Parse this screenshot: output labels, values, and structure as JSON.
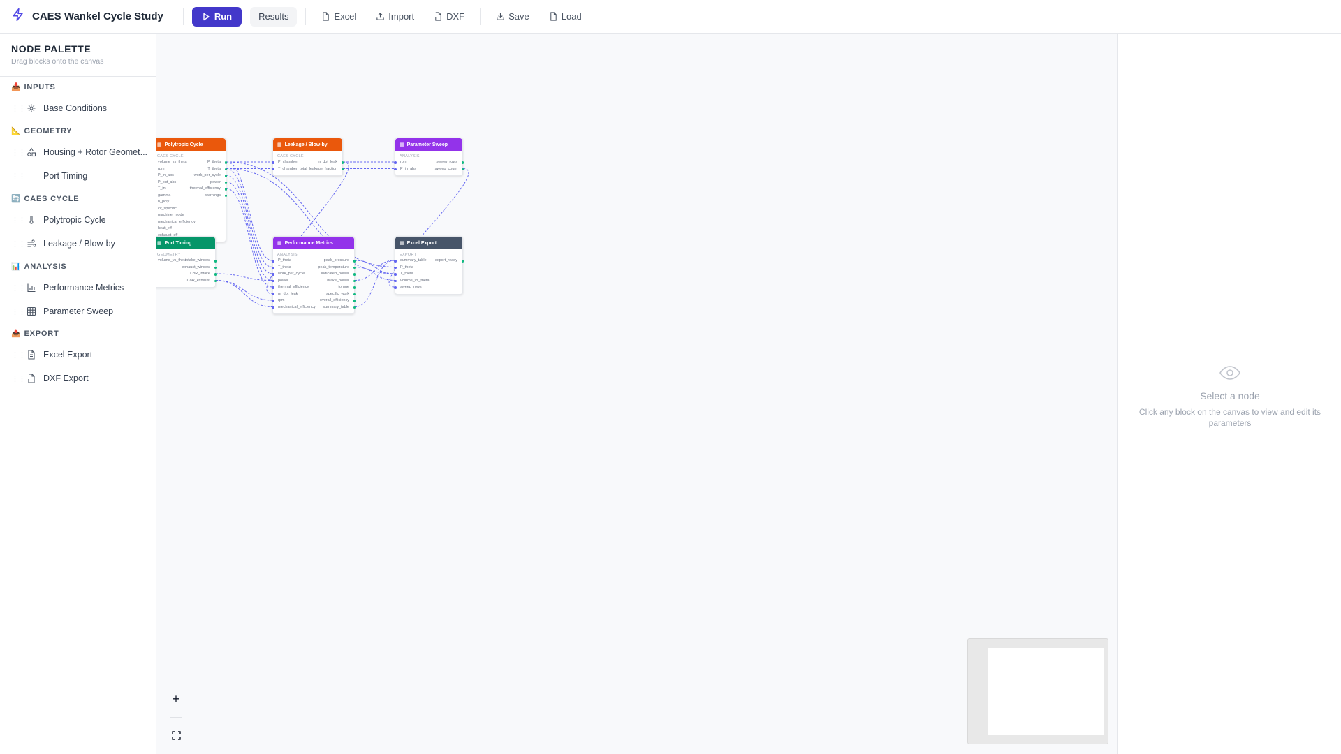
{
  "app": {
    "title": "CAES Wankel Cycle Study"
  },
  "toolbar": {
    "run_label": "Run",
    "results_label": "Results",
    "excel_label": "Excel",
    "import_label": "Import",
    "dxf_label": "DXF",
    "save_label": "Save",
    "load_label": "Load",
    "accent": "#4338ca"
  },
  "sidebar": {
    "title": "NODE PALETTE",
    "subtitle": "Drag blocks onto the canvas",
    "categories": [
      {
        "label": "INPUTS",
        "emoji": "📥"
      },
      {
        "label": "GEOMETRY",
        "emoji": "📐"
      },
      {
        "label": "CAES CYCLE",
        "emoji": "🔄"
      },
      {
        "label": "ANALYSIS",
        "emoji": "📊"
      },
      {
        "label": "EXPORT",
        "emoji": "📤"
      }
    ],
    "items": [
      {
        "label": "Base Conditions",
        "icon": "gear-icon"
      },
      {
        "label": "Housing + Rotor Geomet...",
        "icon": "shapes-icon"
      },
      {
        "label": "Port Timing",
        "icon": "dot-icon"
      },
      {
        "label": "Polytropic Cycle",
        "icon": "thermometer-icon"
      },
      {
        "label": "Leakage / Blow-by",
        "icon": "wind-icon"
      },
      {
        "label": "Performance Metrics",
        "icon": "bar-chart-icon"
      },
      {
        "label": "Parameter Sweep",
        "icon": "grid-icon"
      },
      {
        "label": "Excel Export",
        "icon": "file-icon"
      },
      {
        "label": "DXF Export",
        "icon": "file-dxf-icon"
      }
    ]
  },
  "nodes": {
    "polytropic": {
      "title": "Polytropic Cycle",
      "category": "CAES CYCLE",
      "color": "#ea580c",
      "inputs": [
        "volume_vs_theta",
        "rpm",
        "P_in_abs",
        "P_out_abs",
        "T_in",
        "gamma",
        "n_poly",
        "cv_specific",
        "machine_mode",
        "mechanical_efficiency",
        "heat_eff",
        "exhaust_eff"
      ],
      "outputs": [
        "P_theta",
        "T_theta",
        "work_per_cycle",
        "power",
        "thermal_efficiency",
        "warnings"
      ]
    },
    "leakage": {
      "title": "Leakage / Blow-by",
      "category": "CAES CYCLE",
      "color": "#ea580c",
      "inputs": [
        "P_chamber",
        "T_chamber"
      ],
      "outputs": [
        "m_dot_leak",
        "total_leakage_fraction"
      ]
    },
    "sweep": {
      "title": "Parameter Sweep",
      "category": "ANALYSIS",
      "color": "#9333ea",
      "inputs": [
        "rpm",
        "P_in_abs"
      ],
      "outputs": [
        "sweep_rows",
        "sweep_count"
      ]
    },
    "port": {
      "title": "Port Timing",
      "category": "GEOMETRY",
      "color": "#059669",
      "inputs": [
        "volume_vs_theta"
      ],
      "outputs": [
        "intake_window",
        "exhaust_window",
        "CoR_intake",
        "CoR_exhaust"
      ]
    },
    "performance": {
      "title": "Performance Metrics",
      "category": "ANALYSIS",
      "color": "#9333ea",
      "inputs": [
        "P_theta",
        "T_theta",
        "work_per_cycle",
        "power",
        "thermal_efficiency",
        "m_dot_leak",
        "rpm",
        "mechanical_efficiency"
      ],
      "outputs": [
        "peak_pressure",
        "peak_temperature",
        "indicated_power",
        "brake_power",
        "torque",
        "specific_work",
        "overall_efficiency",
        "summary_table"
      ]
    },
    "excel": {
      "title": "Excel Export",
      "category": "EXPORT",
      "color": "#475569",
      "inputs": [
        "summary_table",
        "P_theta",
        "T_theta",
        "volume_vs_theta",
        "sweep_rows"
      ],
      "outputs": [
        "export_ready"
      ]
    }
  },
  "right_panel": {
    "title": "Select a node",
    "subtitle": "Click any block on the canvas to view and edit its parameters"
  }
}
